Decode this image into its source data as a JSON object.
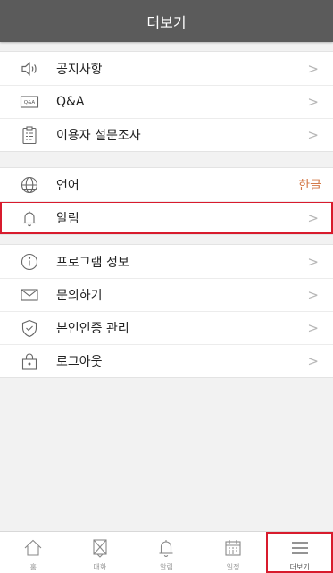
{
  "header": {
    "title": "더보기"
  },
  "groups": [
    {
      "items": [
        {
          "label": "공지사항",
          "icon": "speaker-icon",
          "chevron": ">"
        },
        {
          "label": "Q&A",
          "icon": "qa-icon",
          "icon_text": "Q&A",
          "chevron": ">"
        },
        {
          "label": "이용자 설문조사",
          "icon": "clipboard-icon",
          "chevron": ">"
        }
      ]
    },
    {
      "items": [
        {
          "label": "언어",
          "icon": "globe-icon",
          "value": "한글"
        },
        {
          "label": "알림",
          "icon": "bell-icon",
          "chevron": ">",
          "highlighted": true
        }
      ]
    },
    {
      "items": [
        {
          "label": "프로그램 정보",
          "icon": "info-icon",
          "chevron": ">"
        },
        {
          "label": "문의하기",
          "icon": "mail-icon",
          "chevron": ">"
        },
        {
          "label": "본인인증 관리",
          "icon": "shield-check-icon",
          "chevron": ">"
        },
        {
          "label": "로그아웃",
          "icon": "lock-icon",
          "chevron": ">"
        }
      ]
    }
  ],
  "tabbar": [
    {
      "label": "홈",
      "icon": "home-icon"
    },
    {
      "label": "대화",
      "icon": "chat-icon"
    },
    {
      "label": "알림",
      "icon": "bell-icon"
    },
    {
      "label": "일정",
      "icon": "calendar-icon"
    },
    {
      "label": "더보기",
      "icon": "menu-icon",
      "active": true
    }
  ],
  "colors": {
    "header_bg": "#5b5b5b",
    "value_accent": "#d47a4a",
    "highlight": "#d81b2d"
  }
}
